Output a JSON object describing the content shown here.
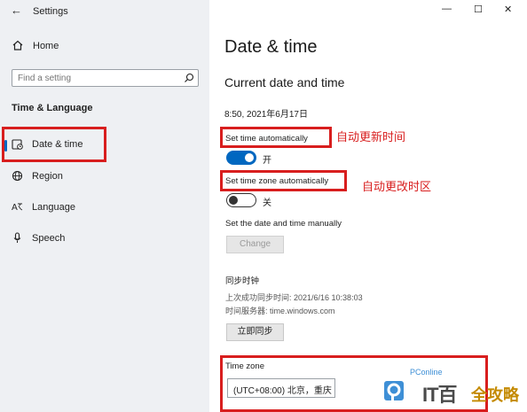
{
  "app": {
    "title": "Settings",
    "back_glyph": "←"
  },
  "window_controls": {
    "minimize": "—",
    "maximize": "☐",
    "close": "✕"
  },
  "sidebar": {
    "home": "Home",
    "search_placeholder": "Find a setting",
    "section": "Time & Language",
    "items": [
      {
        "label": "Date & time",
        "icon": "clock-icon",
        "selected": true
      },
      {
        "label": "Region",
        "icon": "globe-icon"
      },
      {
        "label": "Language",
        "icon": "language-icon"
      },
      {
        "label": "Speech",
        "icon": "microphone-icon"
      }
    ]
  },
  "main": {
    "title": "Date & time",
    "subtitle": "Current date and time",
    "current": "8:50, 2021年6月17日",
    "auto_time": {
      "label": "Set time automatically",
      "state": "开",
      "on": true
    },
    "auto_zone": {
      "label": "Set time zone automatically",
      "state": "关",
      "on": false
    },
    "manual": {
      "label": "Set the date and time manually",
      "button": "Change"
    },
    "sync": {
      "heading": "同步时钟",
      "last": "上次成功同步时间: 2021/6/16 10:38:03",
      "server": "时间服务器: time.windows.com",
      "button": "立即同步"
    },
    "timezone": {
      "label": "Time zone",
      "value": "(UTC+08:00) 北京，重庆"
    }
  },
  "annotations": {
    "auto_time": "自动更新时间",
    "auto_zone": "自动更改时区"
  },
  "watermark": {
    "brand": "PConline",
    "big": "IT百",
    "cn": "全攻略"
  },
  "colors": {
    "accent": "#0067c0",
    "highlight": "#d81e1e"
  }
}
